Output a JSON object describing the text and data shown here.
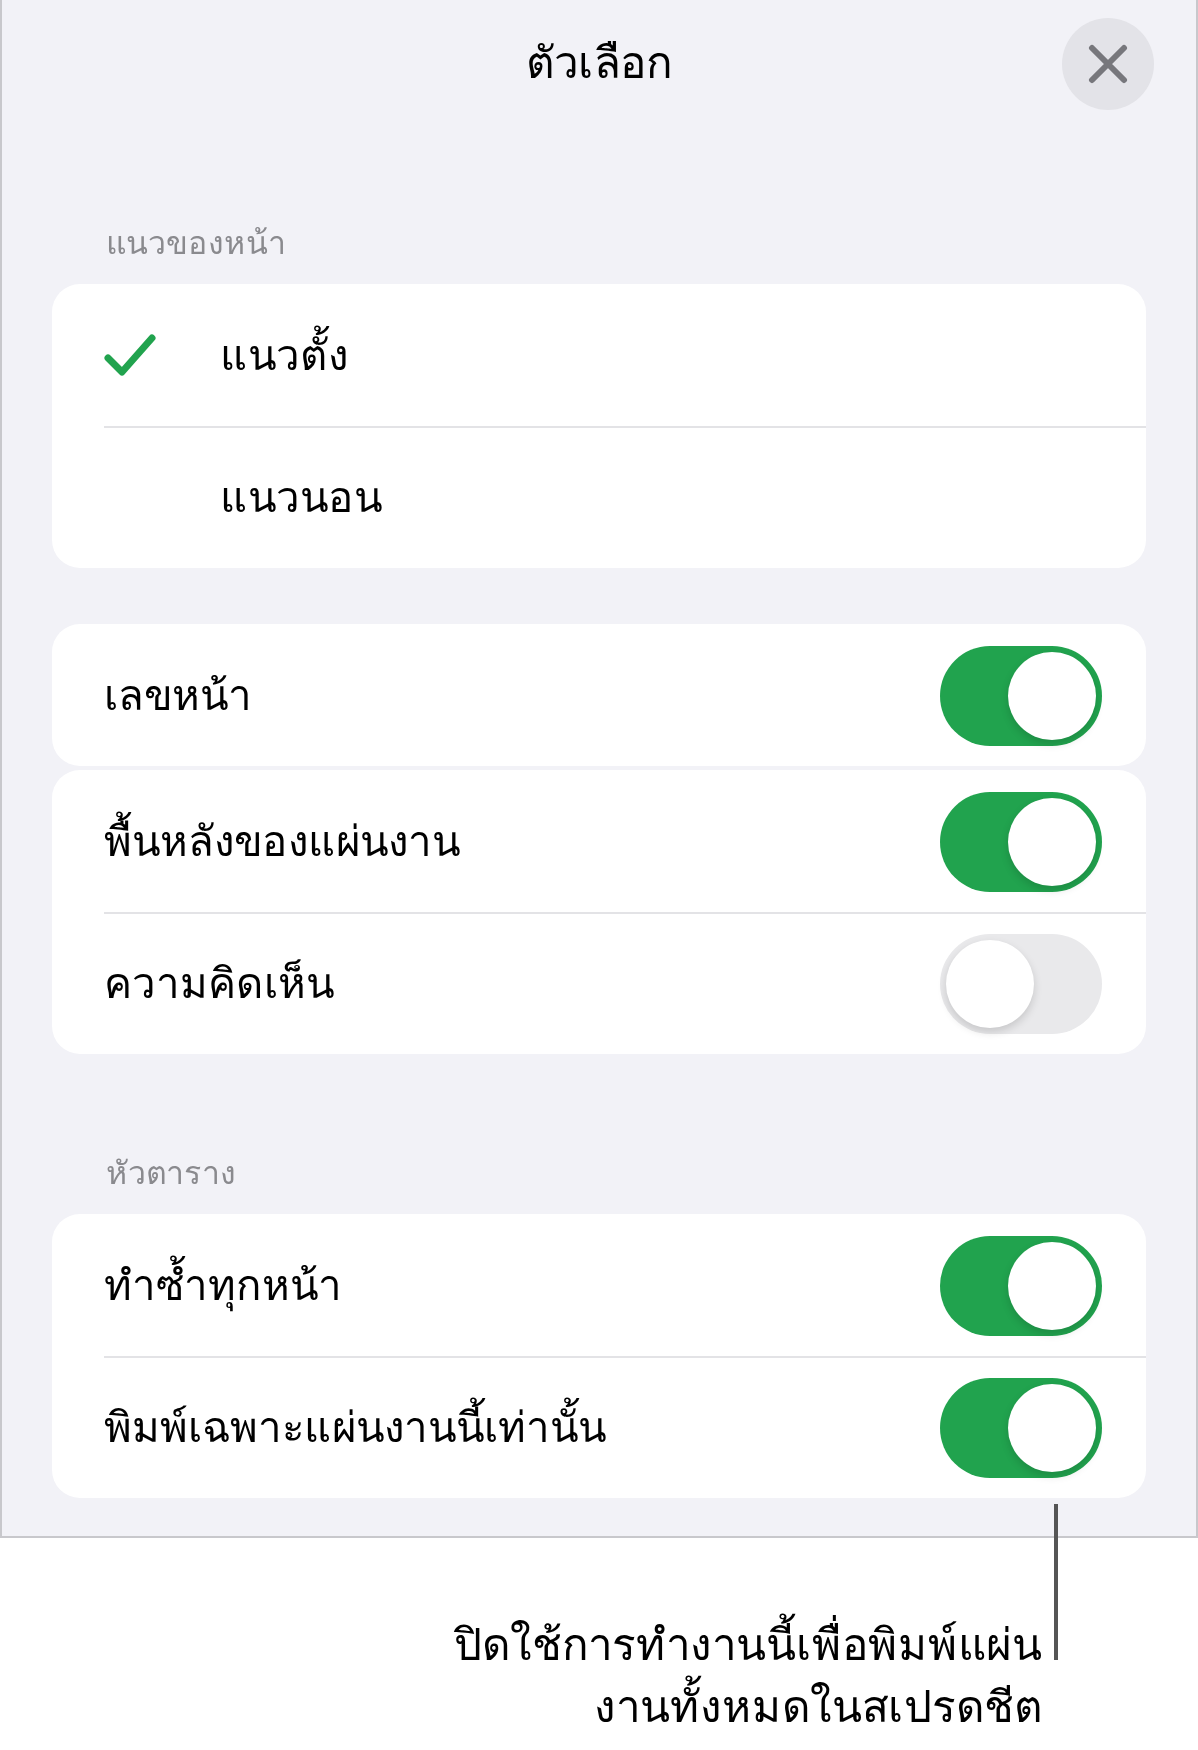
{
  "title": "ตัวเลือก",
  "sections": [
    {
      "header": "แนวของหน้า",
      "groups": [
        {
          "rows": [
            {
              "kind": "choice",
              "label": "แนวตั้ง",
              "selected": true
            },
            {
              "kind": "choice",
              "label": "แนวนอน",
              "selected": false
            }
          ]
        }
      ]
    },
    {
      "groups": [
        {
          "rows": [
            {
              "kind": "toggle",
              "label": "เลขหน้า",
              "on": true
            }
          ]
        },
        {
          "rows": [
            {
              "kind": "toggle",
              "label": "พื้นหลังของแผ่นงาน",
              "on": true
            },
            {
              "kind": "toggle",
              "label": "ความคิดเห็น",
              "on": false
            }
          ]
        }
      ]
    },
    {
      "header": "หัวตาราง",
      "groups": [
        {
          "rows": [
            {
              "kind": "toggle",
              "label": "ทำซ้ำทุกหน้า",
              "on": true
            },
            {
              "kind": "toggle",
              "label": "พิมพ์เฉพาะแผ่นงานนี้เท่านั้น",
              "on": true
            }
          ]
        }
      ]
    }
  ],
  "callout": {
    "lines": [
      "ปิดใช้การทำงานนี้เพื่อพิมพ์แผ่น",
      "งานทั้งหมดในสเปรดชีต"
    ]
  }
}
